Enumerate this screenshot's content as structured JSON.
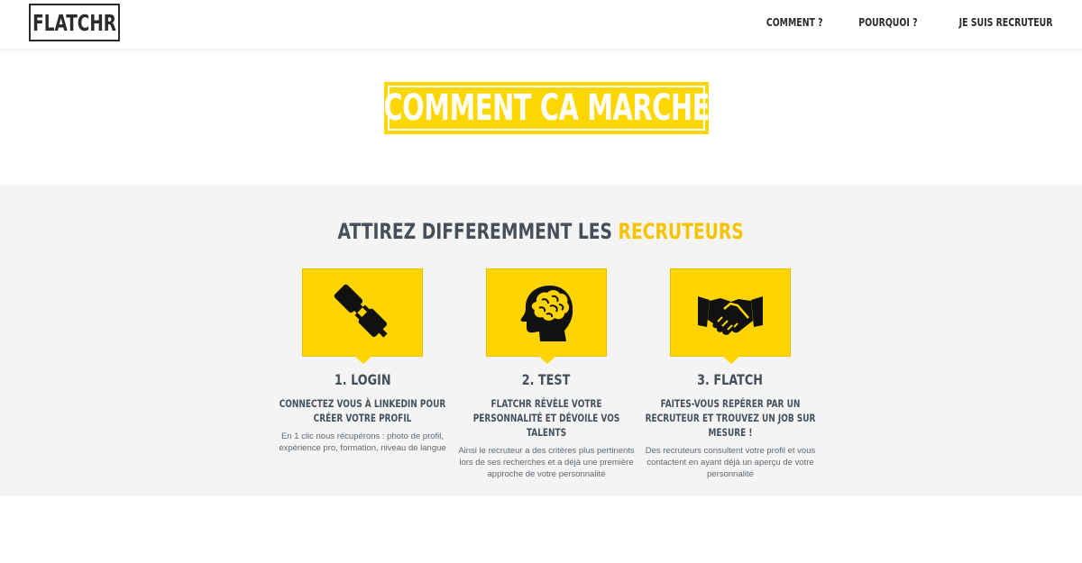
{
  "header": {
    "logo": "FLATCHR",
    "nav": [
      "COMMENT ?",
      "POURQUOI ?",
      "JE SUIS RECRUTEUR"
    ]
  },
  "hero": {
    "title": "COMMENT CA MARCHE"
  },
  "features": {
    "title_main": "ATTIREZ DIFFEREMMENT LES",
    "title_accent": "RECRUTEURS",
    "cards": [
      {
        "icon": "plug-icon",
        "title": "1. LOGIN",
        "subtitle": "CONNECTEZ VOUS À LINKEDIN POUR CRÉER VOTRE PROFIL",
        "text": "En 1 clic nous récupérons : photo de profil, expérience pro, formation, niveau de langue"
      },
      {
        "icon": "brain-head-icon",
        "title": "2. TEST",
        "subtitle": "FLATCHR RÉVÈLE VOTRE PERSONNALITÉ ET DÉVOILE VOS TALENTS",
        "text": "Ainsi le recruteur a des critères plus pertinents lors de ses recherches et a déjà une première approche de votre personnalité"
      },
      {
        "icon": "handshake-icon",
        "title": "3. FLATCH",
        "subtitle": "FAITES-VOUS REPÉRER PAR UN RECRUTEUR ET TROUVEZ UN JOB SUR MESURE !",
        "text": "Des recruteurs consultent votre profil et vous contactent en ayant déjà un aperçu de votre personnalité"
      }
    ]
  },
  "colors": {
    "accent": "#ffd700",
    "text": "#45505a",
    "section_bg": "#f4f4f4"
  }
}
